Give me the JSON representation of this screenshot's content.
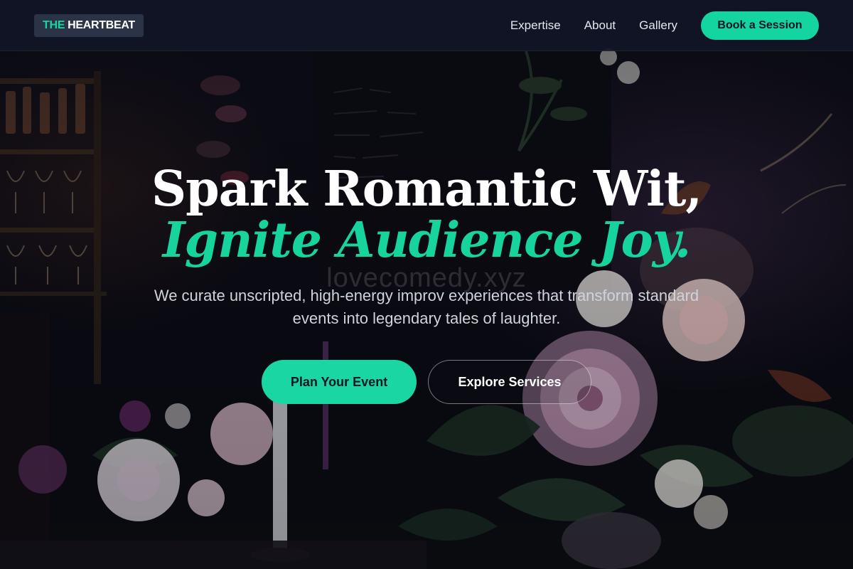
{
  "header": {
    "logo_accent": "THE",
    "logo_rest": "HEARTBEAT",
    "nav": [
      "Expertise",
      "About",
      "Gallery"
    ],
    "cta_label": "Book a Session"
  },
  "hero": {
    "title_line1": "Spark Romantic Wit,",
    "title_line2": "Ignite Audience Joy.",
    "watermark": "lovecomedy.xyz",
    "subtitle": "We curate unscripted, high-energy improv experiences that transform standard events into legendary tales of laughter.",
    "primary_cta": "Plan Your Event",
    "secondary_cta": "Explore Services"
  },
  "colors": {
    "accent": "#14d4a0",
    "header_bg": "#111626",
    "page_bg": "#0b0d14",
    "text": "#ffffff"
  }
}
